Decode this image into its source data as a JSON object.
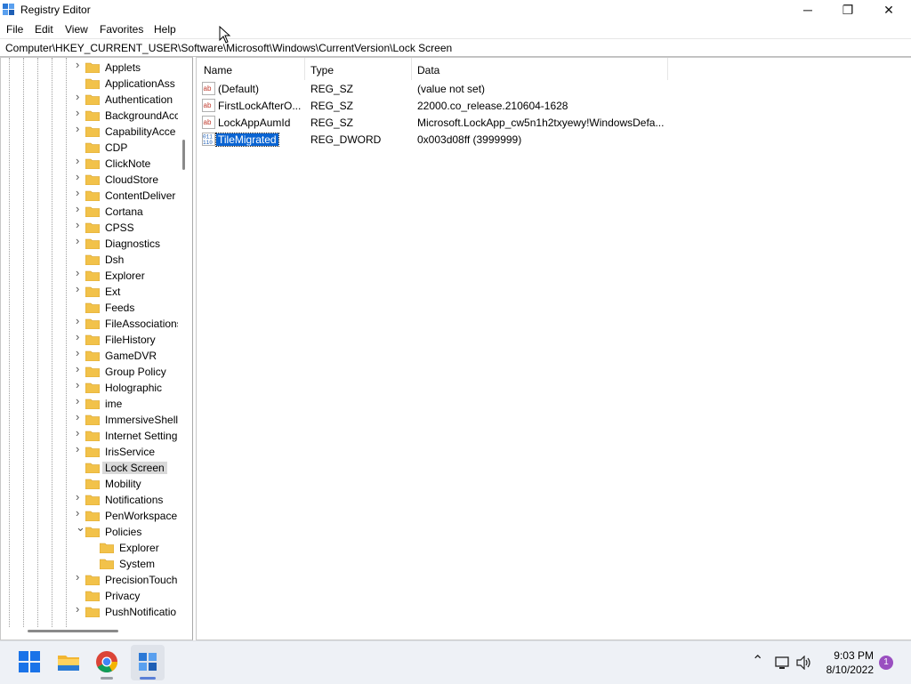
{
  "window": {
    "title": "Registry Editor",
    "minimize_glyph": "─",
    "maximize_glyph": "❐",
    "close_glyph": "✕"
  },
  "menu": [
    "File",
    "Edit",
    "View",
    "Favorites",
    "Help"
  ],
  "address": "Computer\\HKEY_CURRENT_USER\\Software\\Microsoft\\Windows\\CurrentVersion\\Lock Screen",
  "tree": {
    "items": [
      {
        "label": "Applets",
        "expand": true
      },
      {
        "label": "ApplicationAss",
        "expand": false
      },
      {
        "label": "Authentication",
        "expand": true
      },
      {
        "label": "BackgroundAcc",
        "expand": true
      },
      {
        "label": "CapabilityAcce",
        "expand": true
      },
      {
        "label": "CDP",
        "expand": false
      },
      {
        "label": "ClickNote",
        "expand": true
      },
      {
        "label": "CloudStore",
        "expand": true
      },
      {
        "label": "ContentDeliver",
        "expand": true
      },
      {
        "label": "Cortana",
        "expand": true
      },
      {
        "label": "CPSS",
        "expand": true
      },
      {
        "label": "Diagnostics",
        "expand": true
      },
      {
        "label": "Dsh",
        "expand": false
      },
      {
        "label": "Explorer",
        "expand": true
      },
      {
        "label": "Ext",
        "expand": true
      },
      {
        "label": "Feeds",
        "expand": false
      },
      {
        "label": "FileAssociations",
        "expand": true
      },
      {
        "label": "FileHistory",
        "expand": true
      },
      {
        "label": "GameDVR",
        "expand": true
      },
      {
        "label": "Group Policy",
        "expand": true
      },
      {
        "label": "Holographic",
        "expand": true
      },
      {
        "label": "ime",
        "expand": true
      },
      {
        "label": "ImmersiveShell",
        "expand": true
      },
      {
        "label": "Internet Setting",
        "expand": true
      },
      {
        "label": "IrisService",
        "expand": true
      },
      {
        "label": "Lock Screen",
        "expand": false,
        "selected": true
      },
      {
        "label": "Mobility",
        "expand": false
      },
      {
        "label": "Notifications",
        "expand": true
      },
      {
        "label": "PenWorkspace",
        "expand": true
      },
      {
        "label": "Policies",
        "expand": true,
        "open": true
      },
      {
        "label": "Explorer",
        "expand": false,
        "child": true
      },
      {
        "label": "System",
        "expand": false,
        "child": true
      },
      {
        "label": "PrecisionTouch",
        "expand": true
      },
      {
        "label": "Privacy",
        "expand": false
      },
      {
        "label": "PushNotificatio",
        "expand": true
      }
    ]
  },
  "list": {
    "columns": [
      "Name",
      "Type",
      "Data"
    ],
    "rows": [
      {
        "name": "(Default)",
        "type": "REG_SZ",
        "data": "(value not set)",
        "icon": "string-value-icon"
      },
      {
        "name": "FirstLockAfterO...",
        "type": "REG_SZ",
        "data": "22000.co_release.210604-1628",
        "icon": "string-value-icon"
      },
      {
        "name": "LockAppAumId",
        "type": "REG_SZ",
        "data": "Microsoft.LockApp_cw5n1h2txyewy!WindowsDefa...",
        "icon": "string-value-icon"
      },
      {
        "name": "TileMigrated",
        "type": "REG_DWORD",
        "data": "0x003d08ff (3999999)",
        "icon": "binary-value-icon",
        "selected": true
      }
    ]
  },
  "taskbar": {
    "time": "9:03 PM",
    "date": "8/10/2022",
    "notification_count": "1",
    "apps": [
      "windows-start-icon",
      "file-explorer-icon",
      "chrome-icon",
      "registry-editor-icon"
    ]
  },
  "colors": {
    "selection": "#0a64d2",
    "folder": "#f2c24a",
    "taskbar": "#eef1f6",
    "badge": "#9a4fc0"
  }
}
